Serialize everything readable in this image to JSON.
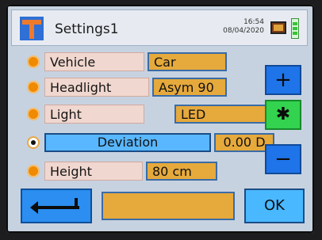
{
  "header": {
    "title": "Settings1",
    "time": "16:54",
    "date": "08/04/2020",
    "icons": {
      "logo": "app-logo-icon",
      "device": "device-icon",
      "battery": "battery-icon"
    }
  },
  "settings": [
    {
      "id": "vehicle",
      "label": "Vehicle",
      "value": "Car",
      "selected": false
    },
    {
      "id": "headlight",
      "label": "Headlight",
      "value": "Asym 90",
      "selected": false
    },
    {
      "id": "light",
      "label": "Light",
      "value": "LED",
      "selected": false
    },
    {
      "id": "deviation",
      "label": "Deviation",
      "value": "0.00 D",
      "selected": true
    },
    {
      "id": "height",
      "label": "Height",
      "value": "80 cm",
      "selected": false
    }
  ],
  "controls": {
    "plus_label": "+",
    "center_label": "✱",
    "minus_label": "−",
    "ok_label": "OK",
    "back_icon": "back-arrow-icon",
    "message": ""
  },
  "colors": {
    "screen_bg": "#c7d2e0",
    "value_bg": "#e6a93c",
    "accent_blue": "#1e74e8",
    "accent_green": "#33d24f",
    "label_bg": "#f0d7cf",
    "radio_orange": "#f08a00"
  }
}
